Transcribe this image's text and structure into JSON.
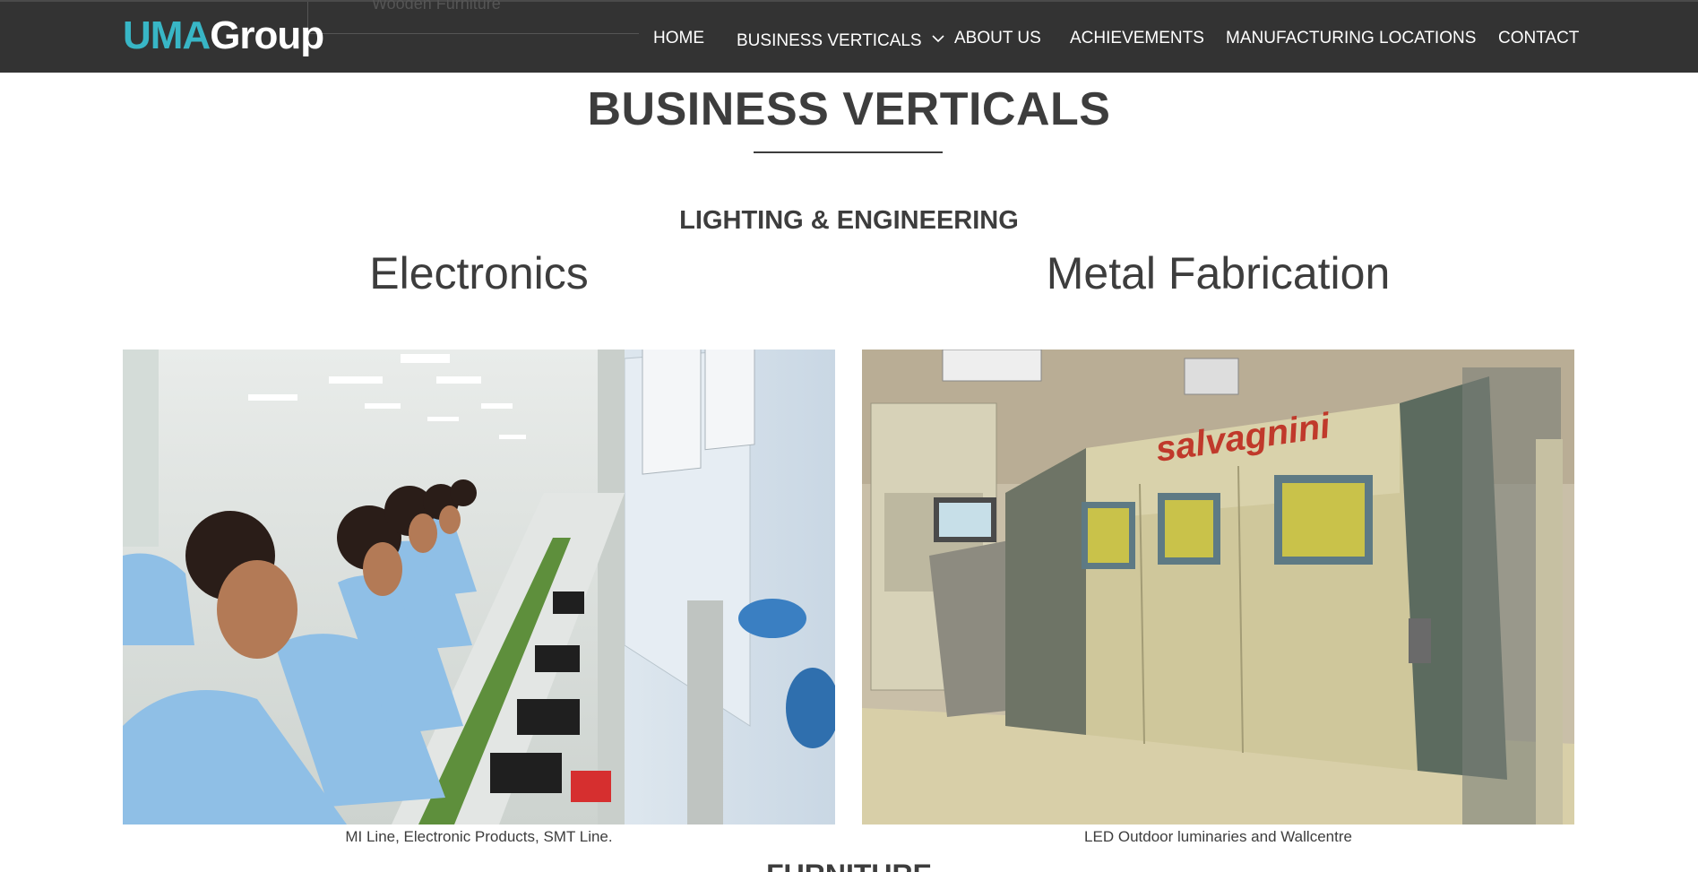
{
  "header": {
    "ghost_text": "Wooden Furniture",
    "logo": {
      "part1": "UMA",
      "part2": "Group"
    },
    "nav": [
      {
        "label": "HOME"
      },
      {
        "label": "BUSINESS VERTICALS"
      },
      {
        "label": "ABOUT US"
      },
      {
        "label": "ACHIEVEMENTS"
      },
      {
        "label": "MANUFACTURING LOCATIONS"
      },
      {
        "label": "CONTACT"
      }
    ]
  },
  "main": {
    "title": "BUSINESS VERTICALS",
    "subsection": "LIGHTING & ENGINEERING",
    "verticals": [
      {
        "title": "Electronics",
        "caption": "MI Line, Electronic Products, SMT Line."
      },
      {
        "title": "Metal Fabrication",
        "caption": "LED Outdoor luminaries and Wallcentre"
      }
    ],
    "next_section": "FURNITURE"
  },
  "colors": {
    "nav_bg": "#333333",
    "logo_accent": "#38b6c6",
    "text": "#3d3d3d"
  },
  "icons": {
    "dropdown": "chevron-down-icon"
  }
}
